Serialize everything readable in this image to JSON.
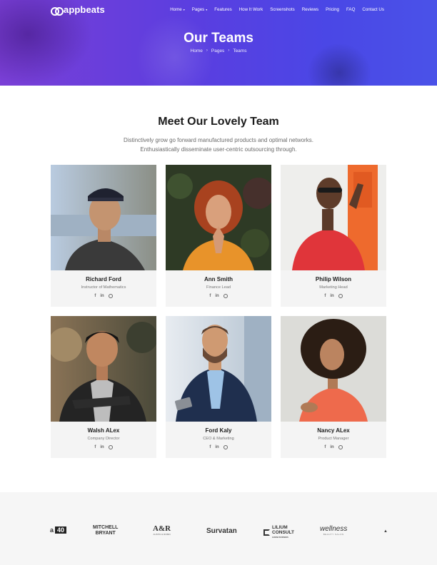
{
  "brand": {
    "name": "appbeats"
  },
  "nav": {
    "items": [
      {
        "label": "Home",
        "has_dropdown": true
      },
      {
        "label": "Pages",
        "has_dropdown": true
      },
      {
        "label": "Features",
        "has_dropdown": false
      },
      {
        "label": "How It Work",
        "has_dropdown": false
      },
      {
        "label": "Screenshots",
        "has_dropdown": false
      },
      {
        "label": "Reviews",
        "has_dropdown": false
      },
      {
        "label": "Pricing",
        "has_dropdown": false
      },
      {
        "label": "FAQ",
        "has_dropdown": false
      },
      {
        "label": "Contact Us",
        "has_dropdown": false
      }
    ]
  },
  "hero": {
    "title": "Our Teams",
    "breadcrumb": [
      "Home",
      "Pages",
      "Teams"
    ],
    "gradient": [
      "#7a3fd6",
      "#4a52e8"
    ]
  },
  "section": {
    "title": "Meet Our Lovely Team",
    "desc_line1": "Distinctively grow go forward manufactured products and optimal networks.",
    "desc_line2": "Enthusiastically disseminate user-centric outsourcing through."
  },
  "team": [
    {
      "name": "Richard Ford",
      "role": "Instructor of Mathematics"
    },
    {
      "name": "Ann Smith",
      "role": "Finance Lead"
    },
    {
      "name": "Philip Wilson",
      "role": "Marketing Head"
    },
    {
      "name": "Walsh ALex",
      "role": "Company Director"
    },
    {
      "name": "Ford Kaly",
      "role": "CEO & Marketing"
    },
    {
      "name": "Nancy ALex",
      "role": "Product Manager"
    }
  ],
  "social": {
    "facebook": "f",
    "linkedin": "in"
  },
  "brands": {
    "b40": {
      "a": "a",
      "b": "40"
    },
    "mitchell": {
      "line1": "MITCHELL",
      "line2": "BRYANT"
    },
    "ar": {
      "main": "A&R",
      "sub": "AUSTIN & ROBIN"
    },
    "survatan": "Survatan",
    "lilium": {
      "line1": "LILIUM",
      "line2": "CONSULT",
      "sub": "HUMAN BUSINESS"
    },
    "wellness": {
      "main": "wellness",
      "sub": "BEAUTY SALON"
    }
  }
}
